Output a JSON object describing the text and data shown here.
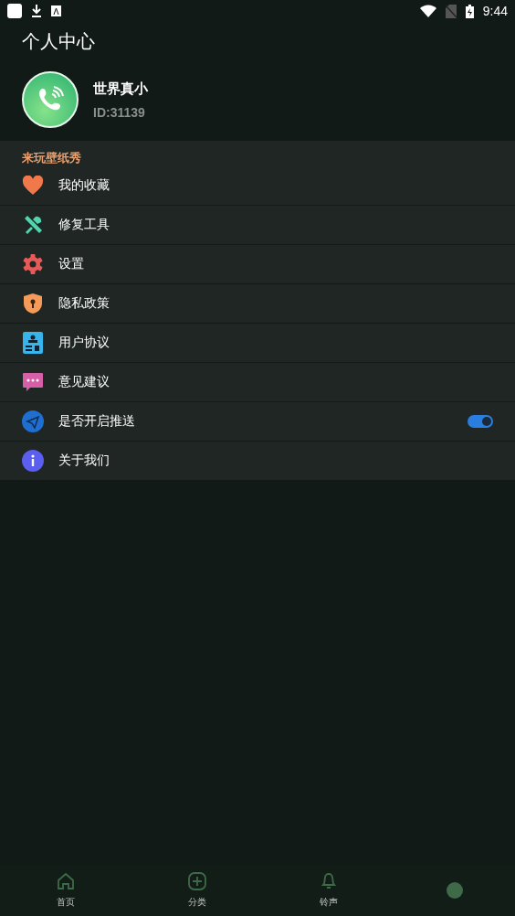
{
  "status_bar": {
    "time": "9:44"
  },
  "title": "个人中心",
  "profile": {
    "name": "世界真小",
    "id": "ID:31139"
  },
  "section_title": "来玩壁纸秀",
  "menu": [
    {
      "kind": "link",
      "label": "我的收藏"
    },
    {
      "kind": "link",
      "label": "修复工具"
    },
    {
      "kind": "link",
      "label": "设置"
    },
    {
      "kind": "link",
      "label": "隐私政策"
    },
    {
      "kind": "link",
      "label": "用户协议"
    },
    {
      "kind": "link",
      "label": "意见建议"
    },
    {
      "kind": "toggle",
      "label": "是否开启推送",
      "on": true
    },
    {
      "kind": "link",
      "label": "关于我们"
    }
  ],
  "nav": [
    {
      "label": "首页"
    },
    {
      "label": "分类"
    },
    {
      "label": "铃声"
    }
  ]
}
